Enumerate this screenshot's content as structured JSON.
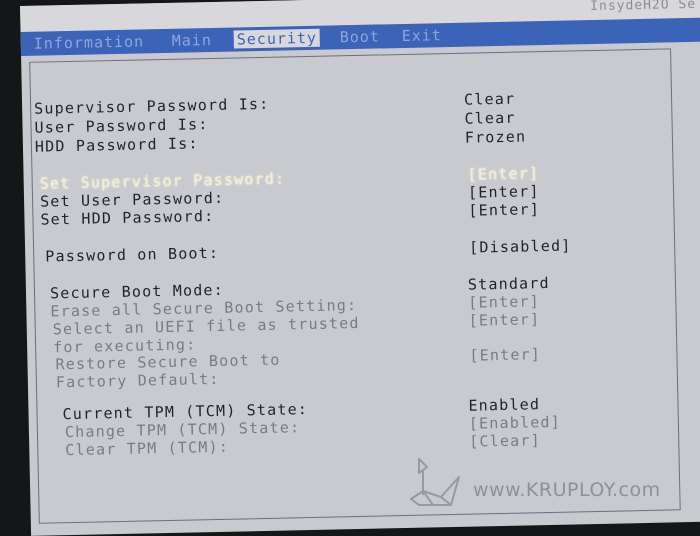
{
  "header": {
    "model": "InsydeH2O Se"
  },
  "menu": [
    {
      "label": "Information"
    },
    {
      "label": "Main"
    },
    {
      "label": "Security"
    },
    {
      "label": "Boot"
    },
    {
      "label": "Exit"
    }
  ],
  "rows": [
    {
      "label": "Supervisor Password Is:",
      "value": "Clear"
    },
    {
      "label": "User Password Is:",
      "value": "Clear"
    },
    {
      "label": "HDD Password Is:",
      "value": "Frozen"
    },
    {
      "label": "Set Supervisor Password:",
      "value": "[Enter]"
    },
    {
      "label": "Set User Password:",
      "value": "[Enter]"
    },
    {
      "label": "Set HDD Password:",
      "value": "[Enter]"
    },
    {
      "label": "Password on Boot:",
      "value": "[Disabled]"
    },
    {
      "label": "Secure Boot Mode:",
      "value": "Standard"
    },
    {
      "label": "Erase all Secure Boot Setting:",
      "value": "[Enter]"
    },
    {
      "label": "Select an UEFI file as trusted",
      "value": "[Enter]"
    },
    {
      "label": "for executing:",
      "value": ""
    },
    {
      "label": "Restore Secure Boot to",
      "value": "[Enter]"
    },
    {
      "label": "Factory Default:",
      "value": ""
    },
    {
      "label": "Current TPM (TCM) State:",
      "value": "Enabled"
    },
    {
      "label": "Change TPM (TCM) State:",
      "value": "[Enabled]"
    },
    {
      "label": "Clear TPM (TCM):",
      "value": "[Clear]"
    }
  ],
  "watermark": {
    "text": "www.KRUPLOY.com"
  }
}
